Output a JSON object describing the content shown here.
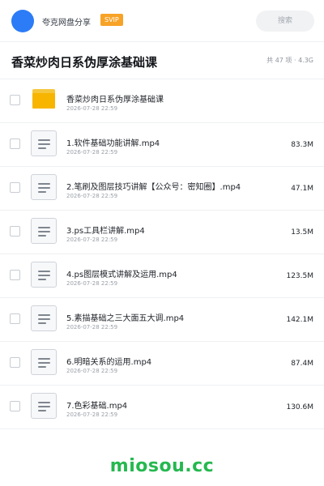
{
  "header": {
    "app_name": "夸克网盘分享",
    "badge": "SVIP",
    "search_label": "搜索"
  },
  "folder": {
    "title": "香菜炒肉日系伪厚涂基础课",
    "meta": "共 47 项 · 4.3G"
  },
  "items": [
    {
      "name": "香菜炒肉日系伪厚涂基础课",
      "date": "2026-07-28 22:59",
      "size": "",
      "type": "folder-icon"
    },
    {
      "name": "1.软件基础功能讲解.mp4",
      "date": "2026-07-28 22:59",
      "size": "83.3M",
      "type": "file-icon"
    },
    {
      "name": "2.笔刷及图层技巧讲解【公众号：密知圈】.mp4",
      "date": "2026-07-28 22:59",
      "size": "47.1M",
      "type": "file-icon"
    },
    {
      "name": "3.ps工具栏讲解.mp4",
      "date": "2026-07-28 22:59",
      "size": "13.5M",
      "type": "file-icon"
    },
    {
      "name": "4.ps图层模式讲解及运用.mp4",
      "date": "2026-07-28 22:59",
      "size": "123.5M",
      "type": "file-icon"
    },
    {
      "name": "5.素描基础之三大面五大调.mp4",
      "date": "2026-07-28 22:59",
      "size": "142.1M",
      "type": "file-icon"
    },
    {
      "name": "6.明暗关系的运用.mp4",
      "date": "2026-07-28 22:59",
      "size": "87.4M",
      "type": "file-icon"
    },
    {
      "name": "7.色彩基础.mp4",
      "date": "2026-07-28 22:59",
      "size": "130.6M",
      "type": "file-icon"
    }
  ],
  "watermark": "miosou.cc",
  "colors": {
    "accent": "#2b7cf6",
    "badge": "#f7a327",
    "folder": "#f7b500",
    "watermark": "#25b84f"
  }
}
